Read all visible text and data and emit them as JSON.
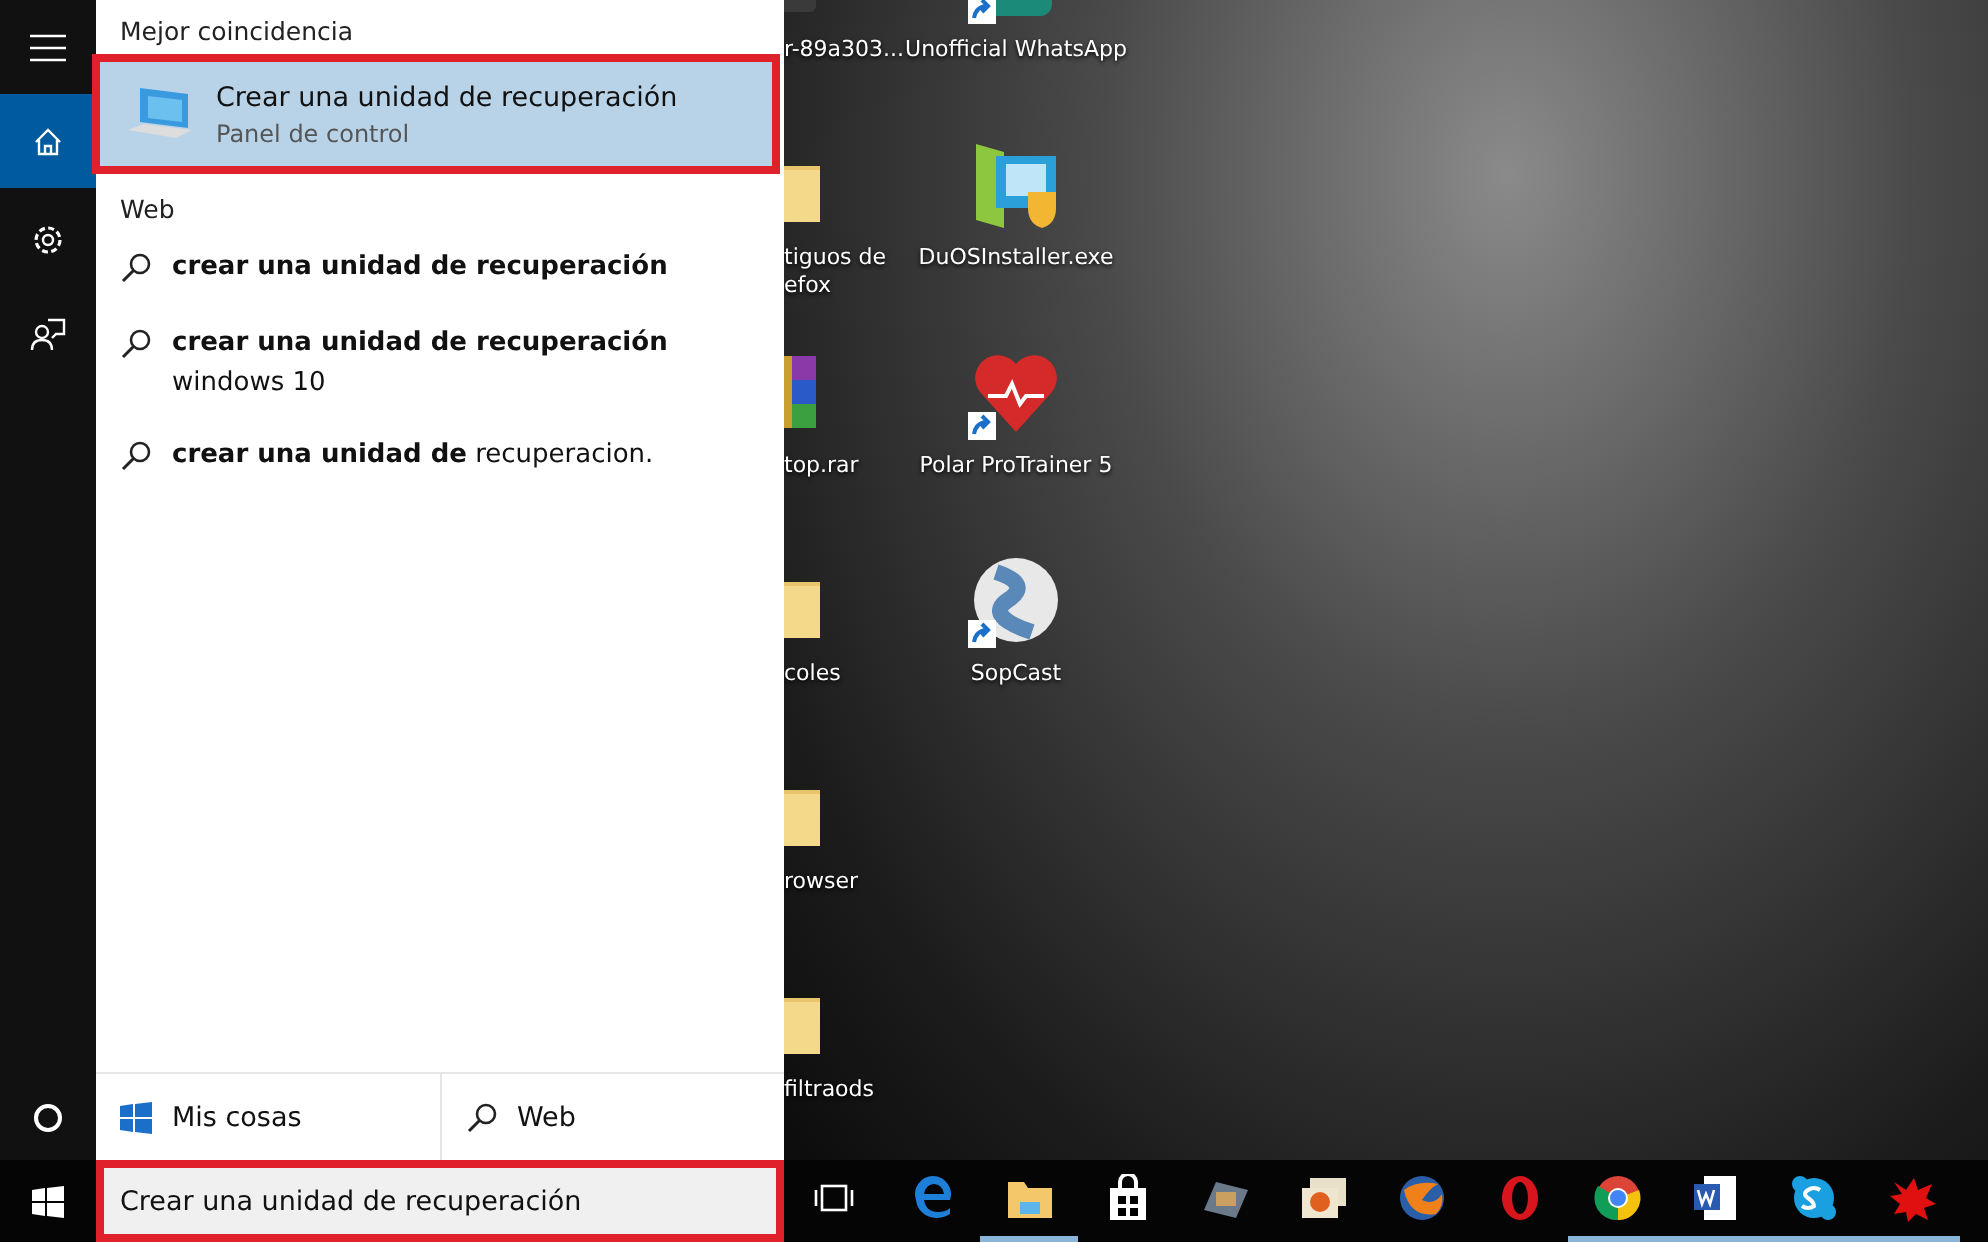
{
  "rail": {
    "items": [
      {
        "kind": "home",
        "selected": true
      },
      {
        "kind": "settings",
        "selected": false
      },
      {
        "kind": "feedback",
        "selected": false
      }
    ]
  },
  "panel": {
    "best_match_heading": "Mejor coincidencia",
    "best_match": {
      "title": "Crear una unidad de recuperación",
      "subtitle": "Panel de control",
      "selected": true,
      "highlighted": true
    },
    "web_heading": "Web",
    "web_results": [
      {
        "text": "**crear una unidad de recuperación**"
      },
      {
        "text": "**crear una unidad de recuperación**",
        "detail": "windows 10"
      },
      {
        "text": "**crear una unidad de** recuperacion."
      }
    ],
    "scopes": [
      {
        "kind": "windows",
        "label": "Mis cosas"
      },
      {
        "kind": "search",
        "label": "Web"
      }
    ]
  },
  "desktop": {
    "left_column_icons": [
      {
        "kind": "app",
        "label": "r-89a303..."
      },
      {
        "kind": "folder",
        "label": "tiguos de\nefox"
      },
      {
        "kind": "archive",
        "label": "top.rar"
      },
      {
        "kind": "folder",
        "label": "coles"
      },
      {
        "kind": "folder",
        "label": "rowser"
      },
      {
        "kind": "folder",
        "label": "filtraods"
      }
    ],
    "right_column_icons": [
      {
        "kind": "chat",
        "label": "Unofficial WhatsApp",
        "shortcut": true
      },
      {
        "kind": "installer",
        "label": "DuOSInstaller.exe",
        "shortcut": false
      },
      {
        "kind": "heart",
        "label": "Polar ProTrainer 5",
        "shortcut": true
      },
      {
        "kind": "film",
        "label": "SopCast",
        "shortcut": true
      }
    ]
  },
  "taskbar": {
    "search": {
      "value": "Crear una unidad de recuperación",
      "highlighted": true
    },
    "apps": [
      {
        "kind": "browser",
        "running": false
      },
      {
        "kind": "folder",
        "running": true
      },
      {
        "kind": "bag",
        "running": false
      },
      {
        "kind": "film",
        "running": false
      },
      {
        "kind": "photos",
        "running": false
      },
      {
        "kind": "fox",
        "running": false
      },
      {
        "kind": "ring",
        "running": false
      },
      {
        "kind": "wheel",
        "running": true
      },
      {
        "kind": "document",
        "running": true
      },
      {
        "kind": "chat",
        "running": true
      },
      {
        "kind": "splat",
        "running": true
      }
    ]
  }
}
